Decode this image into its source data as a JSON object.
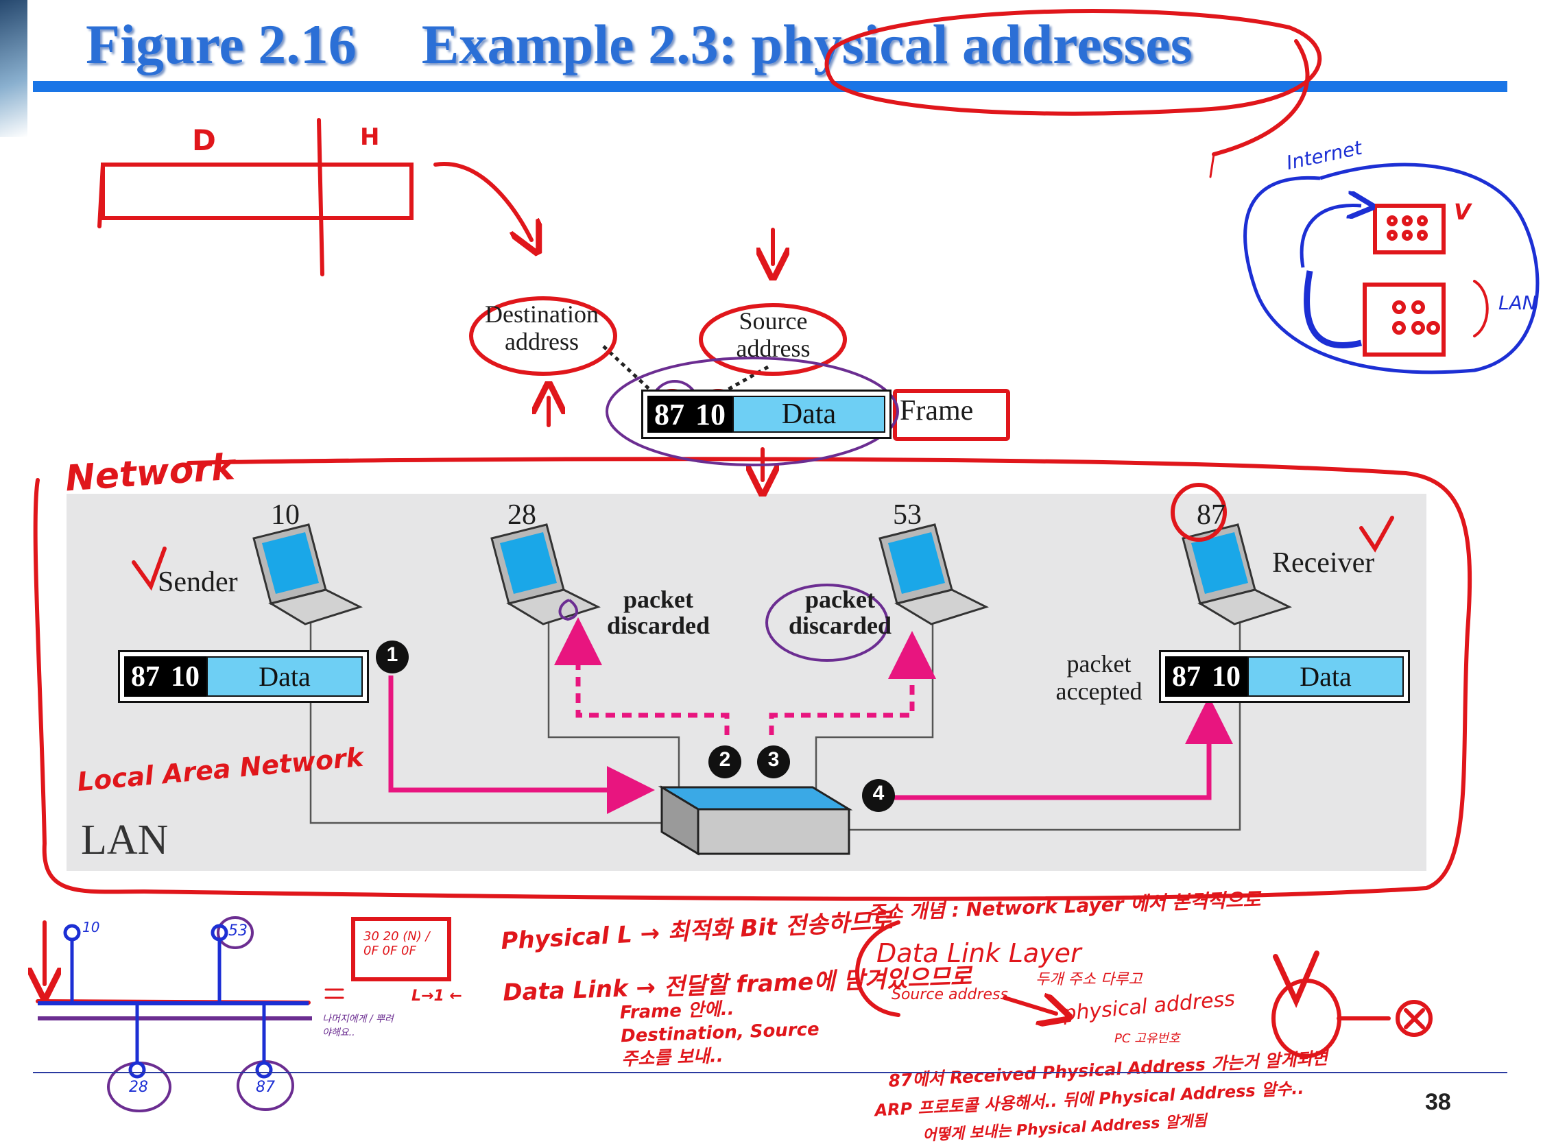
{
  "slide": {
    "figure_number": "Figure 2.16",
    "title": "Example 2.3: physical addresses",
    "page_number": "38"
  },
  "frame_diagram": {
    "destination_label": "Destination\naddress",
    "source_label": "Source\naddress",
    "dest_addr": "87",
    "src_addr": "10",
    "data_label": "Data",
    "frame_label": "Frame"
  },
  "lan": {
    "label": "LAN",
    "stations": [
      {
        "address": "10",
        "role": "Sender"
      },
      {
        "address": "28",
        "status": "packet\ndiscarded"
      },
      {
        "address": "53",
        "status": "packet\ndiscarded"
      },
      {
        "address": "87",
        "role": "Receiver",
        "status": "packet\naccepted"
      }
    ],
    "sender_frame": {
      "dest": "87",
      "src": "10",
      "data": "Data"
    },
    "receiver_frame": {
      "dest": "87",
      "src": "10",
      "data": "Data"
    },
    "steps": [
      "1",
      "2",
      "3",
      "4"
    ]
  },
  "annotations": {
    "header_d": "D",
    "header_h": "H",
    "internet": "Internet",
    "lan_small": "LAN",
    "network": "Network",
    "local_area_network": "Local Area Network",
    "bus_stations": [
      "10",
      "53",
      "28",
      "87"
    ],
    "physical_layer": "Physical L → 최적화 Bit 전송하므로",
    "data_link_layer": "Data Link → 전달할 frame에 담겨있으므로",
    "frame_note": "Frame 안에.. Destination, Source 주소를 보내..",
    "network_note": "주소 개념 : Network Layer 에서 본격적으로",
    "dll_heading": "Data Link Layer",
    "source_address": "Source address",
    "two_addr": "두개 주소 다루고",
    "physical_address": "physical address",
    "pc_note": "PC 고유번호",
    "bottom_note1": "87에서 Received Physical Address 가는거 알게되면",
    "bottom_note2": "ARP 프로토콜 사용해서.. 뒤에 Physical Address 알수..",
    "bottom_note3": "어떻게 보내는 Physical Address 알게됨",
    "box_note": "30 20 (N) / 0F 0F 0F",
    "l1_note": "L→1 ←",
    "small_note": "나머지에게 / 뿌려야해요..",
    "lan_check": "V"
  },
  "colors": {
    "title_blue": "#2b6fd6",
    "rule_blue": "#1a75e6",
    "ink_red": "#e0161b",
    "ink_blue": "#1c2fd4",
    "ink_purple": "#6b2d91",
    "arrow_magenta": "#e8157f",
    "data_cyan": "#6ecff4",
    "lan_gray": "#e6e6e7"
  }
}
